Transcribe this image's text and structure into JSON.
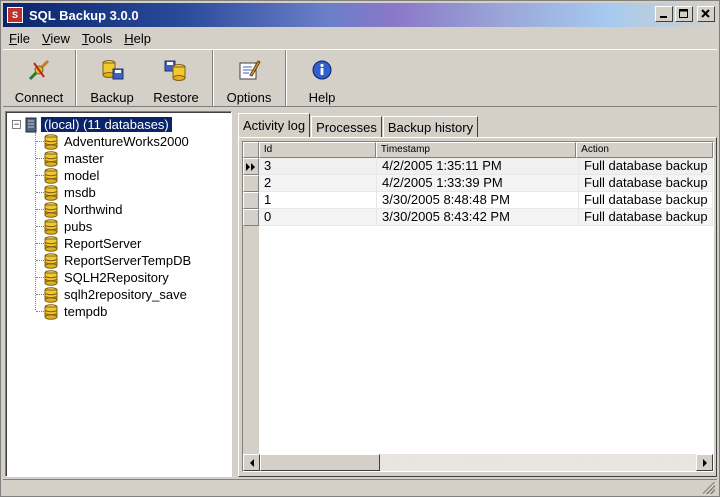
{
  "window": {
    "title": "SQL Backup 3.0.0"
  },
  "menu": [
    {
      "label": "File",
      "ul": "F",
      "rest": "ile"
    },
    {
      "label": "View",
      "ul": "V",
      "rest": "iew"
    },
    {
      "label": "Tools",
      "ul": "T",
      "rest": "ools"
    },
    {
      "label": "Help",
      "ul": "H",
      "rest": "elp"
    }
  ],
  "toolbar": {
    "connect": "Connect",
    "backup": "Backup",
    "restore": "Restore",
    "options": "Options",
    "help": "Help"
  },
  "tree": {
    "root": "(local) (11 databases)",
    "databases": [
      "AdventureWorks2000",
      "master",
      "model",
      "msdb",
      "Northwind",
      "pubs",
      "ReportServer",
      "ReportServerTempDB",
      "SQLH2Repository",
      "sqlh2repository_save",
      "tempdb"
    ]
  },
  "tabs": [
    "Activity log",
    "Processes",
    "Backup history"
  ],
  "grid": {
    "columns": [
      "Id",
      "Timestamp",
      "Action"
    ],
    "rows": [
      {
        "id": "3",
        "timestamp": "4/2/2005 1:35:11 PM",
        "action": "Full database backup"
      },
      {
        "id": "2",
        "timestamp": "4/2/2005 1:33:39 PM",
        "action": "Full database backup"
      },
      {
        "id": "1",
        "timestamp": "3/30/2005 8:48:48 PM",
        "action": "Full database backup"
      },
      {
        "id": "0",
        "timestamp": "3/30/2005 8:43:42 PM",
        "action": "Full database backup"
      }
    ]
  }
}
